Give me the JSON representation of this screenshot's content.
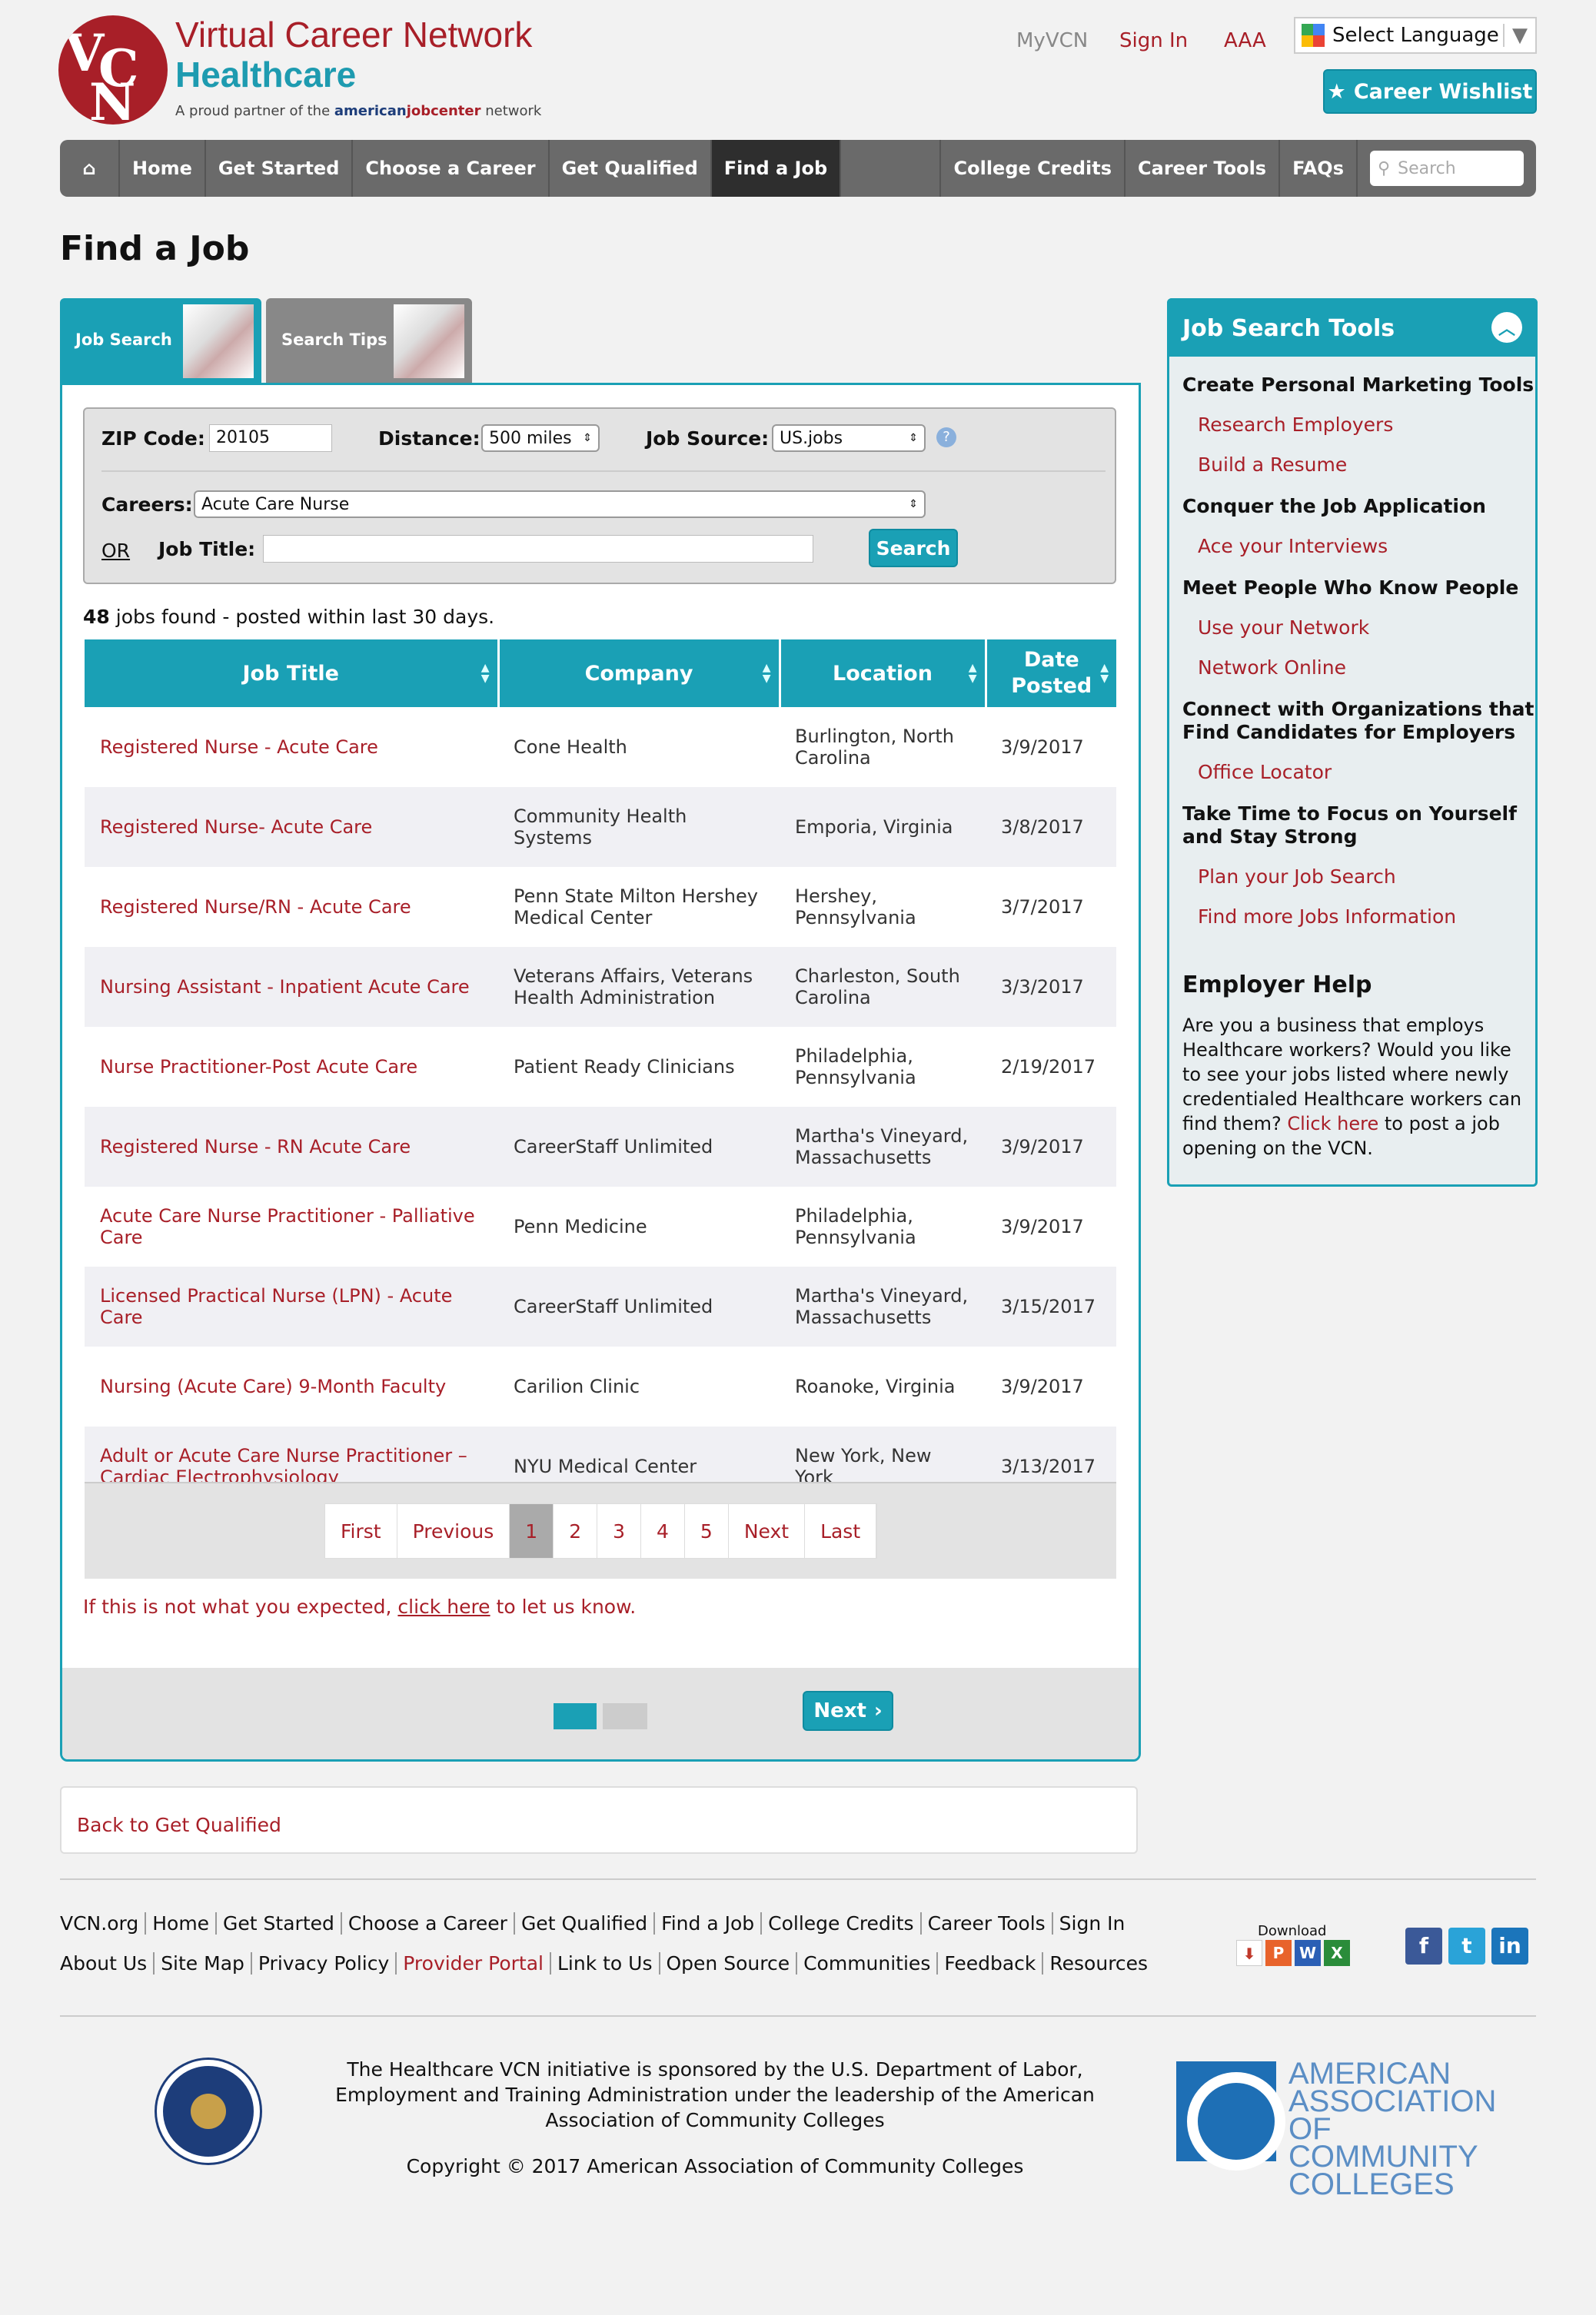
{
  "brand": {
    "line1": "Virtual Career Network",
    "line2": "Healthcare",
    "tag_pre": "A proud partner of the ",
    "tag_american": "american",
    "tag_job": "jobcenter",
    "tag_post": " network"
  },
  "toplinks": {
    "myvcn": "MyVCN",
    "signin": "Sign In",
    "aaa": "AAA"
  },
  "language": {
    "label": "Select Language"
  },
  "wishlist": {
    "label": "Career Wishlist"
  },
  "nav": {
    "items": [
      "Home",
      "Get Started",
      "Choose a Career",
      "Get Qualified",
      "Find a Job",
      "College Credits",
      "Career Tools",
      "FAQs"
    ],
    "search_placeholder": "Search",
    "active": "Find a Job"
  },
  "page": {
    "title": "Find a Job"
  },
  "tabs": [
    "Job Search",
    "Search Tips"
  ],
  "form": {
    "zip_label": "ZIP Code:",
    "zip_value": "20105",
    "distance_label": "Distance:",
    "distance_value": "500 miles",
    "source_label": "Job Source:",
    "source_value": "US.jobs",
    "careers_label": "Careers:",
    "careers_value": "Acute Care Nurse",
    "or": "OR",
    "jobtitle_label": "Job Title:",
    "jobtitle_value": "",
    "search_button": "Search"
  },
  "results": {
    "count": "48",
    "text": " jobs found - posted within last 30 days."
  },
  "table": {
    "headers": [
      "Job Title",
      "Company",
      "Location",
      "Date Posted"
    ],
    "rows": [
      [
        "Registered Nurse - Acute Care",
        "Cone Health",
        "Burlington, North Carolina",
        "3/9/2017"
      ],
      [
        "Registered Nurse- Acute Care",
        "Community Health Systems",
        "Emporia, Virginia",
        "3/8/2017"
      ],
      [
        "Registered Nurse/RN - Acute Care",
        "Penn State Milton Hershey Medical Center",
        "Hershey, Pennsylvania",
        "3/7/2017"
      ],
      [
        "Nursing Assistant - Inpatient Acute Care",
        "Veterans Affairs, Veterans Health Administration",
        "Charleston, South Carolina",
        "3/3/2017"
      ],
      [
        "Nurse Practitioner-Post Acute Care",
        "Patient Ready Clinicians",
        "Philadelphia, Pennsylvania",
        "2/19/2017"
      ],
      [
        "Registered Nurse - RN Acute Care",
        "CareerStaff Unlimited",
        "Martha's Vineyard, Massachusetts",
        "3/9/2017"
      ],
      [
        "Acute Care Nurse Practitioner - Palliative Care",
        "Penn Medicine",
        "Philadelphia, Pennsylvania",
        "3/9/2017"
      ],
      [
        "Licensed Practical Nurse (LPN) - Acute Care",
        "CareerStaff Unlimited",
        "Martha's Vineyard, Massachusetts",
        "3/15/2017"
      ],
      [
        "Nursing (Acute Care) 9-Month Faculty",
        "Carilion Clinic",
        "Roanoke, Virginia",
        "3/9/2017"
      ],
      [
        "Adult or Acute Care Nurse Practitioner – Cardiac Electrophysiology",
        "NYU Medical Center",
        "New York, New York",
        "3/13/2017"
      ]
    ]
  },
  "pager": {
    "items": [
      "First",
      "Previous",
      "1",
      "2",
      "3",
      "4",
      "5",
      "Next",
      "Last"
    ],
    "current": "1"
  },
  "feedback": {
    "pre": "If this is not what you expected, ",
    "link": "click here",
    "post": " to let us know."
  },
  "wizard": {
    "next": "Next"
  },
  "back": {
    "label": "Back to Get Qualified"
  },
  "sidebar": {
    "title": "Job Search Tools",
    "sections": [
      {
        "heading": "Create Personal Marketing Tools",
        "links": [
          "Research Employers",
          "Build a Resume"
        ]
      },
      {
        "heading": "Conquer the Job Application",
        "links": [
          "Ace your Interviews"
        ]
      },
      {
        "heading": "Meet People Who Know People",
        "links": [
          "Use your Network",
          "Network Online"
        ]
      },
      {
        "heading": "Connect with Organizations that Find Candidates for Employers",
        "links": [
          "Office Locator"
        ]
      },
      {
        "heading": "Take Time to Focus on Yourself and Stay Strong",
        "links": [
          "Plan your Job Search",
          "Find more Jobs Information"
        ]
      }
    ],
    "employer_heading": "Employer Help",
    "employer_pre": "Are you a business that employs Healthcare workers? Would you like to see your jobs listed where newly credentialed Healthcare workers can find them? ",
    "employer_link": "Click here",
    "employer_post": " to post a job opening on the VCN."
  },
  "footer": {
    "row1": [
      "VCN.org",
      "Home",
      "Get Started",
      "Choose a Career",
      "Get Qualified",
      "Find a Job",
      "College Credits",
      "Career Tools",
      "Sign In"
    ],
    "row2": [
      "About Us",
      "Site Map",
      "Privacy Policy",
      "Provider Portal",
      "Link to Us",
      "Open Source",
      "Communities",
      "Feedback",
      "Resources"
    ],
    "download": "Download",
    "sponsor": "The Healthcare VCN initiative is sponsored by the U.S. Department of Labor, Employment and Training Administration under the leadership of the American Association of Community Colleges",
    "copyright": "Copyright © 2017 American Association of Community Colleges",
    "aacc": "AMERICAN ASSOCIATION OF COMMUNITY COLLEGES"
  }
}
